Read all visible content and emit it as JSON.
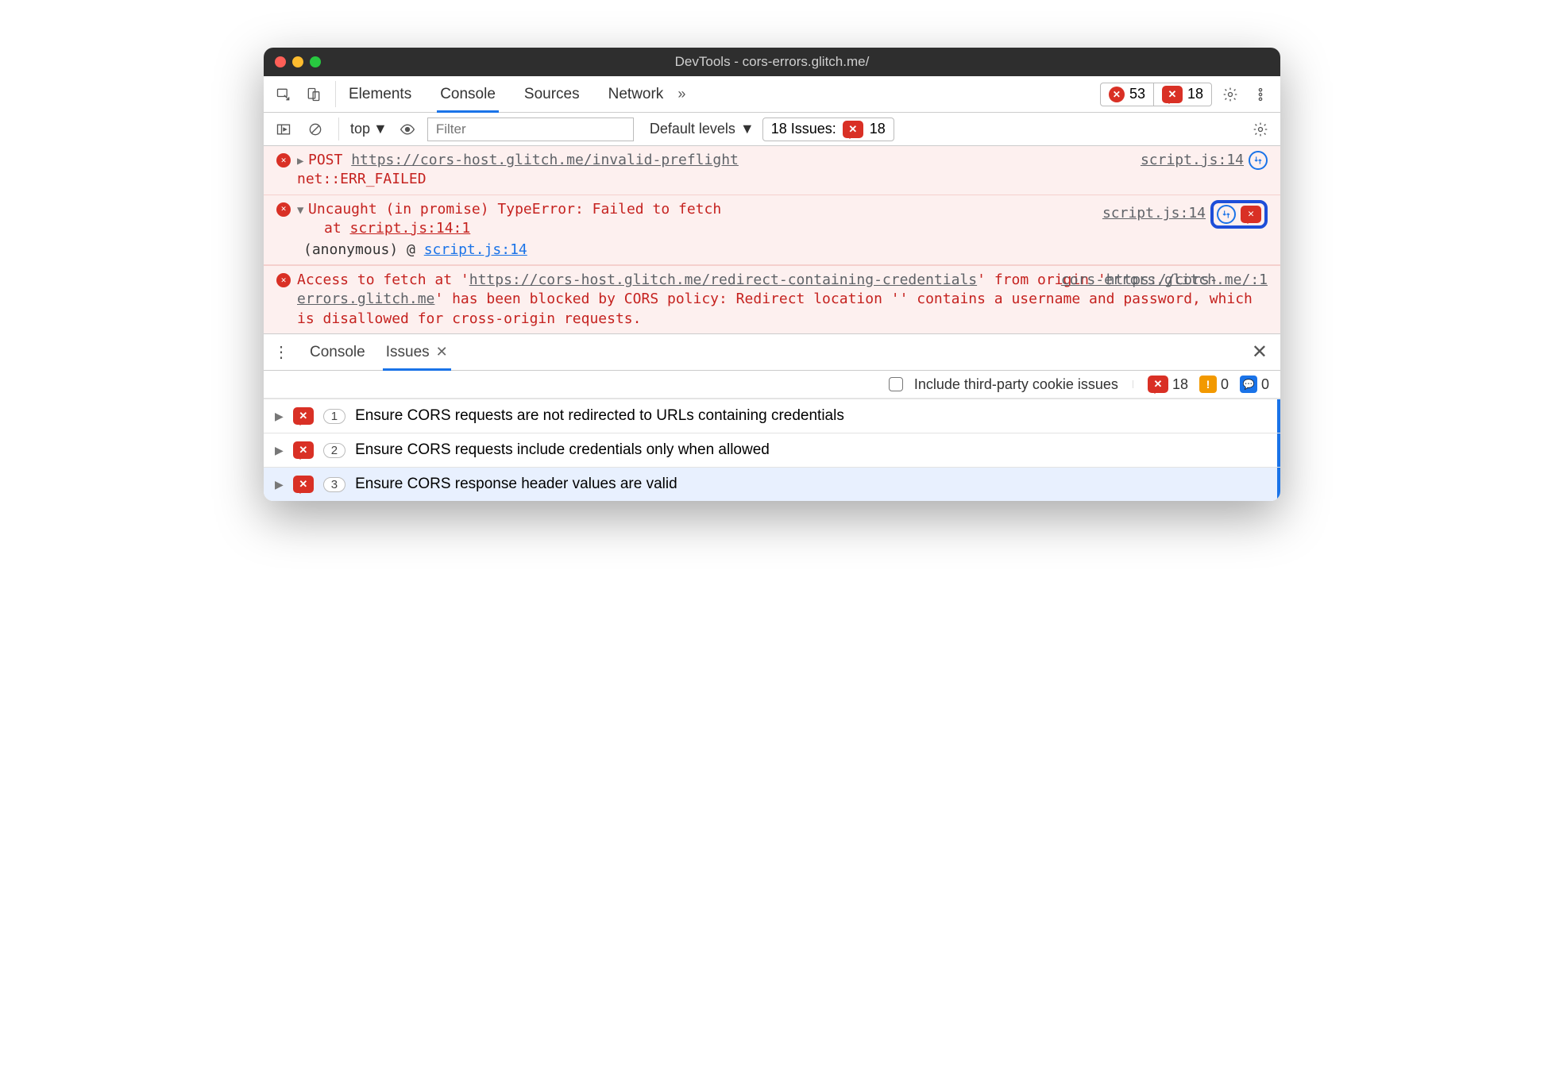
{
  "window": {
    "title": "DevTools - cors-errors.glitch.me/"
  },
  "toolbar": {
    "tabs": [
      "Elements",
      "Console",
      "Sources",
      "Network"
    ],
    "active_tab": "Console",
    "more": "»",
    "error_count": "53",
    "issue_count": "18"
  },
  "toolbar2": {
    "context": "top",
    "filter_placeholder": "Filter",
    "levels": "Default levels",
    "issues_label": "18 Issues:",
    "issues_badge": "18"
  },
  "messages": {
    "m1_method": "POST",
    "m1_url": "https://cors-host.glitch.me/invalid-preflight",
    "m1_status": "net::ERR_FAILED",
    "m1_src": "script.js:14",
    "m2_head": "Uncaught (in promise) TypeError: Failed to fetch",
    "m2_at": "at ",
    "m2_at_link": "script.js:14:1",
    "m2_src": "script.js:14",
    "m2_anon": "(anonymous) @ ",
    "m2_anon_link": "script.js:14",
    "m3_pre": "Access to fetch at '",
    "m3_url1": "https://cors-host.glitch.me/redirect-containing-credentials",
    "m3_mid": "' from origin '",
    "m3_url2": "https://cors-errors.glitch.me",
    "m3_post": "' has been blocked by CORS policy: Redirect location '' contains a username and password, which is disallowed for cross-origin requests.",
    "m3_src": "cors-errors.glitch.me/:1"
  },
  "drawer": {
    "tabs": [
      "Console",
      "Issues"
    ],
    "active": "Issues",
    "include_label": "Include third-party cookie issues",
    "counts": {
      "err": "18",
      "warn": "0",
      "info": "0"
    },
    "rows": [
      {
        "count": "1",
        "text": "Ensure CORS requests are not redirected to URLs containing credentials"
      },
      {
        "count": "2",
        "text": "Ensure CORS requests include credentials only when allowed"
      },
      {
        "count": "3",
        "text": "Ensure CORS response header values are valid"
      }
    ]
  }
}
